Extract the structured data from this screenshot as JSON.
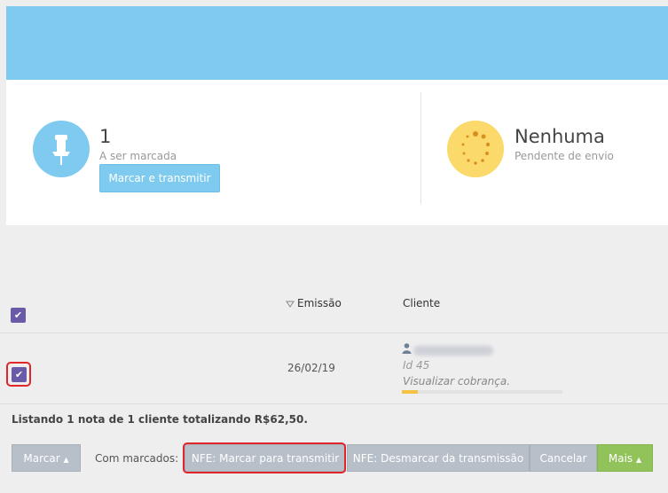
{
  "summary": {
    "to_mark": {
      "count": "1",
      "caption": "A ser marcada",
      "button": "Marcar e transmitir",
      "icon": "pushpin-icon"
    },
    "pending": {
      "value": "Nenhuma",
      "caption": "Pendente de envio",
      "icon": "spinner-icon"
    }
  },
  "table": {
    "columns": {
      "emission": "Emissão",
      "client": "Cliente"
    },
    "sort_icon": "sort-down-icon",
    "rows": [
      {
        "date": "26/02/19",
        "client_id": "Id 45",
        "link": "Visualizar cobrança.",
        "progress": 0.1,
        "checked": true
      }
    ]
  },
  "footer": {
    "summary": "Listando 1 nota de 1 cliente totalizando R$62,50.",
    "mark_button": "Marcar",
    "with_marked_label": "Com marcados:",
    "buttons": {
      "mark_transmit": "NFE: Marcar para transmitir",
      "unmark_transmit": "NFE: Desmarcar da transmissão",
      "cancel": "Cancelar",
      "more": "Mais"
    }
  },
  "colors": {
    "banner": "#7ecbef",
    "checkbox": "#6a5aa8",
    "highlight": "#e0262b",
    "green": "#92c35b"
  }
}
